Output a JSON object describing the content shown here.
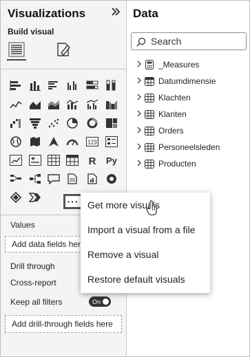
{
  "visualizations": {
    "title": "Visualizations",
    "build_visual_label": "Build visual",
    "collapse_icon": "double-chevron-right-icon",
    "subtabs": [
      "build-visual-icon",
      "format-visual-icon"
    ],
    "visual_icons": [
      "stacked-bar-chart-icon",
      "stacked-column-chart-icon",
      "clustered-bar-chart-icon",
      "clustered-column-chart-icon",
      "100-stacked-bar-chart-icon",
      "100-stacked-column-chart-icon",
      "line-chart-icon",
      "area-chart-icon",
      "stacked-area-chart-icon",
      "line-and-stacked-column-chart-icon",
      "line-and-clustered-column-chart-icon",
      "ribbon-chart-icon",
      "waterfall-chart-icon",
      "funnel-chart-icon",
      "scatter-chart-icon",
      "pie-chart-icon",
      "donut-chart-icon",
      "treemap-icon",
      "map-icon",
      "filled-map-icon",
      "azure-map-icon",
      "gauge-icon",
      "card-icon",
      "multi-row-card-icon",
      "kpi-icon",
      "slicer-icon",
      "table-icon",
      "matrix-icon",
      "r-visual-icon",
      "python-visual-icon",
      "key-influencers-icon",
      "decomposition-tree-icon",
      "qa-icon",
      "smart-narrative-icon",
      "paginated-report-icon",
      "arcgis-icon",
      "power-apps-icon",
      "power-automate-icon",
      "more-visuals-icon"
    ],
    "card_label": "123",
    "r_label": "R",
    "py_label": "Py",
    "more_button_label": "···",
    "values_label": "Values",
    "add_data_fields": "Add data fields her",
    "drill_through_label": "Drill through",
    "cross_report_label": "Cross-report",
    "keep_all_filters_label": "Keep all filters",
    "toggle_label": "On",
    "add_drill_through": "Add drill-through fields here"
  },
  "data_pane": {
    "title": "Data",
    "search_placeholder": "Search",
    "tables": [
      {
        "name": "_Measures",
        "icon": "calculator-icon"
      },
      {
        "name": "Datumdimensie",
        "icon": "calendar-table-icon"
      },
      {
        "name": "Klachten",
        "icon": "table-icon"
      },
      {
        "name": "Klanten",
        "icon": "table-icon"
      },
      {
        "name": "Orders",
        "icon": "table-icon"
      },
      {
        "name": "Personeelsleden",
        "icon": "table-icon"
      },
      {
        "name": "Producten",
        "icon": "table-icon"
      }
    ]
  },
  "context_menu": {
    "items": [
      "Get more visuals",
      "Import a visual from a file",
      "Remove a visual",
      "Restore default visuals"
    ]
  }
}
